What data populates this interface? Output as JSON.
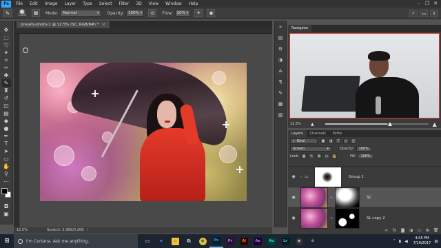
{
  "menubar": {
    "logo": "Ps",
    "items": [
      "File",
      "Edit",
      "Image",
      "Layer",
      "Type",
      "Select",
      "Filter",
      "3D",
      "View",
      "Window",
      "Help"
    ],
    "window_controls": [
      "–",
      "❐",
      "✕"
    ]
  },
  "options_bar": {
    "brush_size": "1120",
    "mode_label": "Mode:",
    "mode_value": "Normal",
    "opacity_label": "Opacity:",
    "opacity_value": "100%",
    "flow_label": "Flow:",
    "flow_value": "20%"
  },
  "document": {
    "tab_title": "presets-photo-1 @ 12.5% (SC, RGB/8#) *",
    "zoom": "12.5%",
    "scratch": "Scratch: 2.36G/3.20G"
  },
  "navigator": {
    "tabs": [
      "Navigator"
    ],
    "zoom": "12.5%",
    "zoom_fraction": 0.6
  },
  "layers": {
    "tabs": [
      "Layers",
      "Channels",
      "Paths"
    ],
    "filter_kind": "Kind",
    "blend_mode": "Screen",
    "opacity_label": "Opacity:",
    "opacity_value": "100%",
    "lock_label": "Lock:",
    "fill_label": "Fill:",
    "fill_value": "100%",
    "items": [
      {
        "name": "Group 1",
        "type": "group"
      },
      {
        "name": "SC",
        "type": "layer"
      },
      {
        "name": "SL copy 2",
        "type": "layer"
      }
    ]
  },
  "taskbar": {
    "cortana_placeholder": "I'm Cortana. Ask me anything.",
    "time": "4:05 PM",
    "date": "7/19/2017"
  },
  "colors": {
    "accent_ps": "#31a8ff",
    "selected_layer": "#565656",
    "nav_frame": "#d23c2e"
  }
}
